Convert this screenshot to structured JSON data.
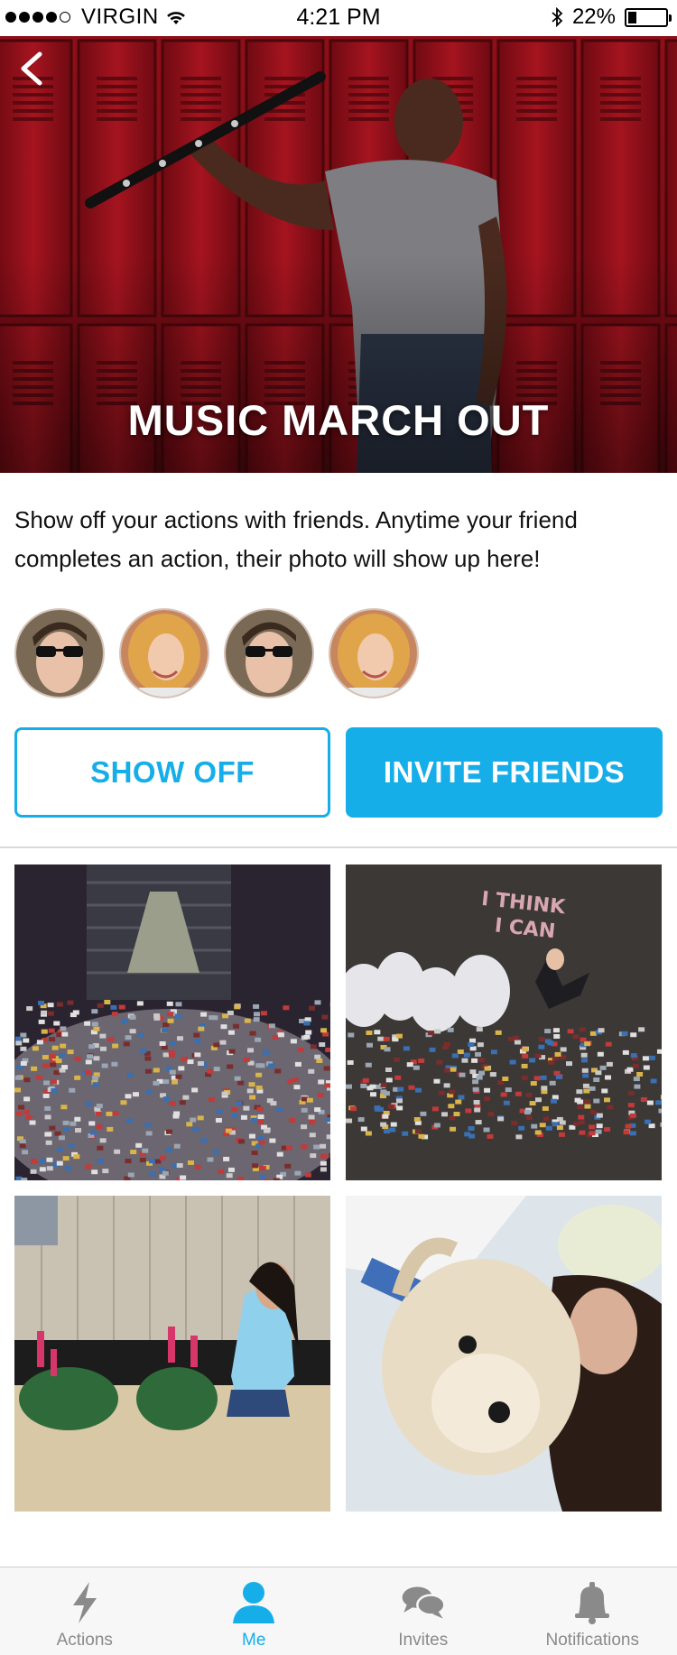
{
  "status_bar": {
    "carrier": "VIRGIN",
    "time": "4:21 PM",
    "battery_percent": "22%",
    "battery_level": 0.22,
    "signal_bars_filled": 4,
    "signal_bars_total": 5
  },
  "hero": {
    "title": "MUSIC MARCH OUT",
    "back_icon": "chevron-left-icon"
  },
  "description": "Show off your actions with friends. Anytime your friend completes an action, their photo will show up here!",
  "friends": [
    {
      "name": "friend-avatar-1"
    },
    {
      "name": "friend-avatar-2"
    },
    {
      "name": "friend-avatar-3"
    },
    {
      "name": "friend-avatar-4"
    }
  ],
  "buttons": {
    "show_off": "SHOW OFF",
    "invite_friends": "INVITE FRIENDS"
  },
  "photos": {
    "photo_2_text_line1": "I THINK",
    "photo_2_text_line2": "I CAN"
  },
  "tabbar": {
    "tabs": [
      {
        "label": "Actions",
        "icon": "lightning-icon",
        "active": false
      },
      {
        "label": "Me",
        "icon": "person-icon",
        "active": true
      },
      {
        "label": "Invites",
        "icon": "chat-bubbles-icon",
        "active": false
      },
      {
        "label": "Notifications",
        "icon": "bell-icon",
        "active": false
      }
    ]
  },
  "colors": {
    "accent": "#16aee8",
    "hero_red": "#8e0f18",
    "tab_inactive": "#8a8a8a"
  }
}
